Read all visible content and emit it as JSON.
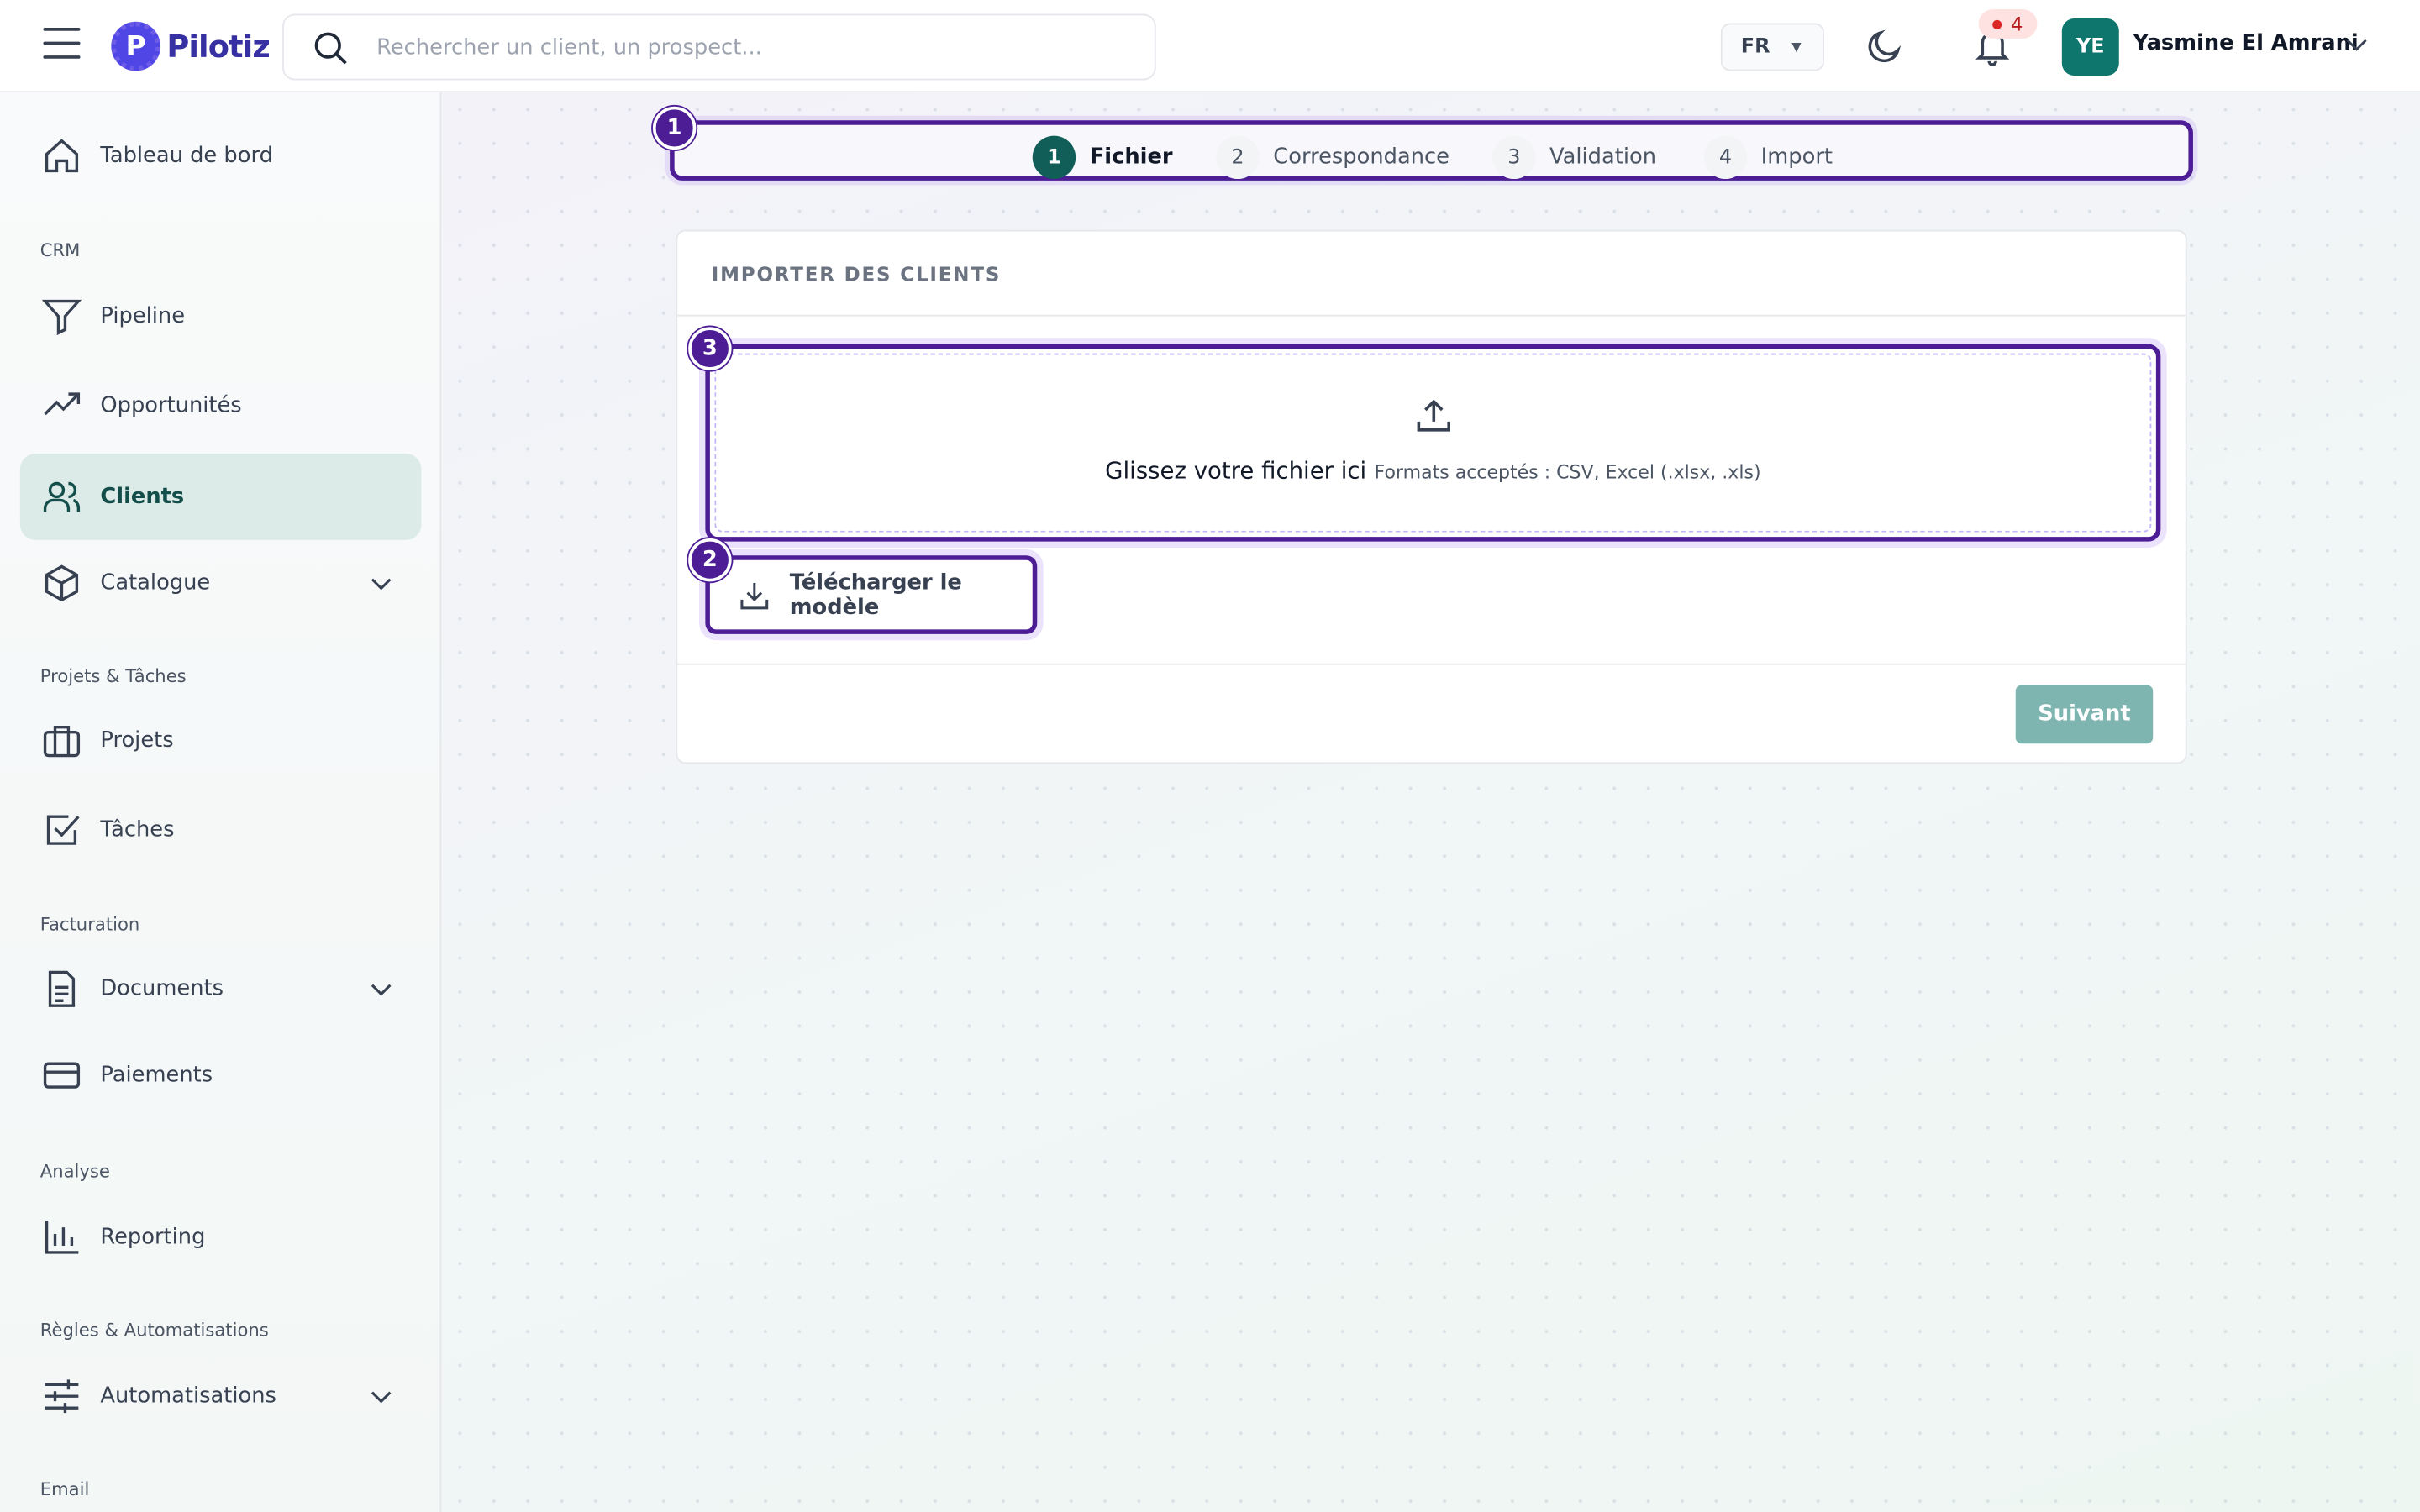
{
  "header": {
    "brand": "Pilotiz",
    "brand_mark": "P",
    "search_placeholder": "Rechercher un client, un prospect...",
    "language": "FR",
    "notifications_count": "4",
    "avatar_initials": "YE",
    "user_name": "Yasmine El Amrani"
  },
  "sidebar": {
    "items": {
      "dashboard": "Tableau de bord",
      "pipeline": "Pipeline",
      "opportunities": "Opportunités",
      "clients": "Clients",
      "catalogue": "Catalogue",
      "projects": "Projets",
      "tasks": "Tâches",
      "documents": "Documents",
      "payments": "Paiements",
      "reporting": "Reporting",
      "automations": "Automatisations"
    },
    "sections": {
      "crm": "CRM",
      "projects": "Projets & Tâches",
      "billing": "Facturation",
      "analysis": "Analyse",
      "rules": "Règles & Automatisations",
      "email": "Email"
    }
  },
  "stepper": {
    "steps": [
      {
        "num": "1",
        "label": "Fichier"
      },
      {
        "num": "2",
        "label": "Correspondance"
      },
      {
        "num": "3",
        "label": "Validation"
      },
      {
        "num": "4",
        "label": "Import"
      }
    ],
    "active": 1
  },
  "markers": {
    "m1": "1",
    "m2": "2",
    "m3": "3"
  },
  "card": {
    "title": "IMPORTER DES CLIENTS",
    "drop_main": "Glissez votre fichier ici",
    "drop_sub": "Formats acceptés : CSV, Excel (.xlsx, .xls)",
    "download_template": "Télécharger le modèle",
    "next": "Suivant"
  },
  "colors": {
    "accent": "#115e59",
    "highlight": "#4c1d95",
    "next_button": "#7fb5b0"
  }
}
